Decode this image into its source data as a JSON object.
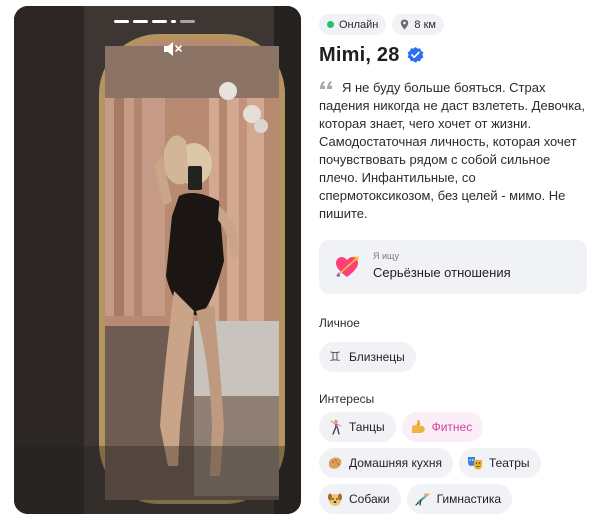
{
  "profile": {
    "status": "Онлайн",
    "distance": "8 км",
    "name_age": "Mimi, 28",
    "bio": "Я не буду больше бояться. Страх падения никогда не даст взлететь. Девочка, которая знает, чего хочет от жизни. Самодостаточная личность, которая хочет почувствовать рядом с собой сильное плечо. Инфантильные, со спермотоксикозом, без целей - мимо. Не пишите."
  },
  "looking_for": {
    "label": "Я ищу",
    "value": "Серьёзные отношения",
    "icon": "heart-arrow-icon"
  },
  "personal": {
    "title": "Личное",
    "zodiac": "Близнецы",
    "zodiac_glyph": "♊"
  },
  "interests": {
    "title": "Интересы",
    "items": [
      {
        "label": "Танцы",
        "icon": "dancer-icon",
        "highlighted": false
      },
      {
        "label": "Фитнес",
        "icon": "flexed-biceps-icon",
        "highlighted": true
      },
      {
        "label": "Домашняя кухня",
        "icon": "bread-icon",
        "highlighted": false
      },
      {
        "label": "Театры",
        "icon": "theater-masks-icon",
        "highlighted": false
      },
      {
        "label": "Собаки",
        "icon": "dog-icon",
        "highlighted": false
      },
      {
        "label": "Гимнастика",
        "icon": "gymnast-icon",
        "highlighted": false
      }
    ]
  },
  "photo": {
    "total": 5,
    "current": 4,
    "mute_icon": "speaker-muted-icon"
  },
  "colors": {
    "online": "#25c06a",
    "verified": "#2b6ef2",
    "chip_bg": "#f1f2f5",
    "highlight_text": "#d63ea0",
    "highlight_bg": "#fbeef6"
  }
}
